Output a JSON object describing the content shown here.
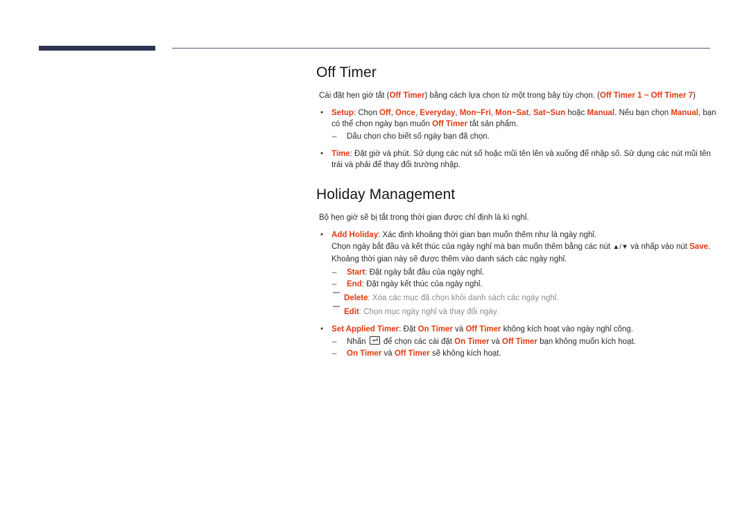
{
  "page": {
    "header_rule": {
      "thick_bar_color": "#2d3450",
      "thin_rule_color": "#55597a"
    },
    "accent_color": "#e0380f",
    "muted_color": "#8c8c8c"
  },
  "sections": [
    {
      "id": "off-timer",
      "title": "Off Timer",
      "intro": {
        "p1": "Cài đặt hẹn giờ tắt (",
        "t1": "Off Timer",
        "p2": ") bằng cách lựa chọn từ một trong bảy tùy chọn. (",
        "t2": "Off Timer 1 ~ Off Timer 7",
        "p3": ")"
      },
      "bullets": [
        {
          "marker": "•",
          "term": "Setup",
          "line1_a": ": Chọn ",
          "opt1": "Off",
          "sep1": ", ",
          "opt2": "Once",
          "sep2": ", ",
          "opt3": "Everyday",
          "sep3": ", ",
          "opt4": "Mon~Fri",
          "sep4": ", ",
          "opt5": "Mon~Sat",
          "sep5": ", ",
          "opt6": "Sat~Sun",
          "line1_b": " hoặc ",
          "opt7": "Manual",
          "line1_c": ". Nếu bạn chọn ",
          "opt8": "Manual",
          "line1_d": ", bạn có thể chọn ngày bạn muốn ",
          "opt9": "Off Timer",
          "line1_e": " tắt sản phẩm.",
          "subs": [
            {
              "marker": "–",
              "text": "Dấu chọn cho biết số ngày bạn đã chọn."
            }
          ]
        },
        {
          "marker": "•",
          "term": "Time",
          "line1_a": ": Đặt giờ và phút. Sử dụng các nút số hoặc mũi tên lên và xuống để nhập số. Sử dụng các nút mũi tên trái và phải để thay đổi trường nhập.",
          "subs": []
        }
      ]
    },
    {
      "id": "holiday-management",
      "title": "Holiday Management",
      "intro_plain": "Bộ hẹn giờ sẽ bị tắt trong thời gian được chỉ định là kì nghỉ.",
      "bullets": [
        {
          "marker": "•",
          "term": "Add Holiday",
          "line1": ": Xác định khoảng thời gian bạn muốn thêm như là ngày nghỉ.",
          "cont1_a": "Chọn ngày bắt đầu và kết thúc của ngày nghỉ mà bạn muốn thêm bằng các nút ",
          "cont1_arrows": "▲/▼",
          "cont1_b": " và nhấp vào nút ",
          "cont1_save": "Save",
          "cont1_c": ".",
          "cont2": "Khoảng thời gian này sẽ được thêm vào danh sách các ngày nghỉ.",
          "subs": [
            {
              "marker": "–",
              "term": "Start",
              "text": ": Đặt ngày bắt đầu của ngày nghỉ."
            },
            {
              "marker": "–",
              "term": "End",
              "text": ": Đặt ngày kết thúc của ngày nghỉ."
            }
          ],
          "notes": [
            {
              "term": "Delete",
              "text": ": Xóa các mục đã chọn khỏi danh sách các ngày nghỉ."
            },
            {
              "term": "Edit",
              "text": ": Chọn mục ngày nghỉ và thay đổi ngày."
            }
          ]
        },
        {
          "marker": "•",
          "term": "Set Applied Timer",
          "line1_a": ": Đặt ",
          "t_on": "On Timer",
          "line1_b": " và ",
          "t_off": "Off Timer",
          "line1_c": " không kích hoạt vào ngày nghỉ công.",
          "subs2": [
            {
              "marker": "–",
              "pre": "Nhấn ",
              "icon": "enter-key-icon",
              "mid": " để chọn các cài đặt ",
              "t_on": "On Timer",
              "mid2": " và ",
              "t_off": "Off Timer",
              "post": " bạn không muốn kích hoạt."
            },
            {
              "marker": "–",
              "t_on": "On Timer",
              "mid": " và ",
              "t_off": "Off Timer",
              "post": " sẽ không kích hoạt."
            }
          ]
        }
      ]
    }
  ]
}
